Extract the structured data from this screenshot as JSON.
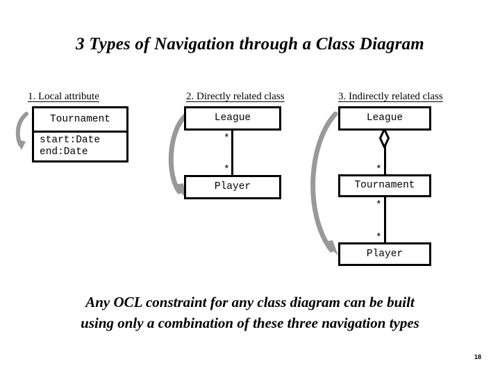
{
  "slide": {
    "title": "3 Types of Navigation through a Class Diagram",
    "page_number": "18",
    "caption_line_1": "Any OCL constraint for any class diagram can be built",
    "caption_line_2": "using only a combination of these three navigation types",
    "colors": {
      "background": "#ffffff",
      "text": "#000000",
      "box_border": "#000000",
      "arrow": "#999999"
    }
  },
  "columns": [
    {
      "header": "1. Local attribute",
      "classes": [
        {
          "name": "Tournament",
          "attributes": [
            "start:Date",
            "end:Date"
          ]
        }
      ],
      "multiplicities": [],
      "arrow": "curved-down-arrow-icon"
    },
    {
      "header": "2. Directly related class",
      "classes": [
        {
          "name": "League",
          "attributes": []
        },
        {
          "name": "Player",
          "attributes": []
        }
      ],
      "multiplicities": [
        "*",
        "*"
      ],
      "arrow": "curved-down-arrow-icon"
    },
    {
      "header": "3. Indirectly related class",
      "classes": [
        {
          "name": "League",
          "attributes": []
        },
        {
          "name": "Tournament",
          "attributes": []
        },
        {
          "name": "Player",
          "attributes": []
        }
      ],
      "multiplicities": [
        "*",
        "*",
        "*"
      ],
      "aggregation_symbol": "diamond-icon",
      "arrow": "curved-down-arrow-icon"
    }
  ]
}
